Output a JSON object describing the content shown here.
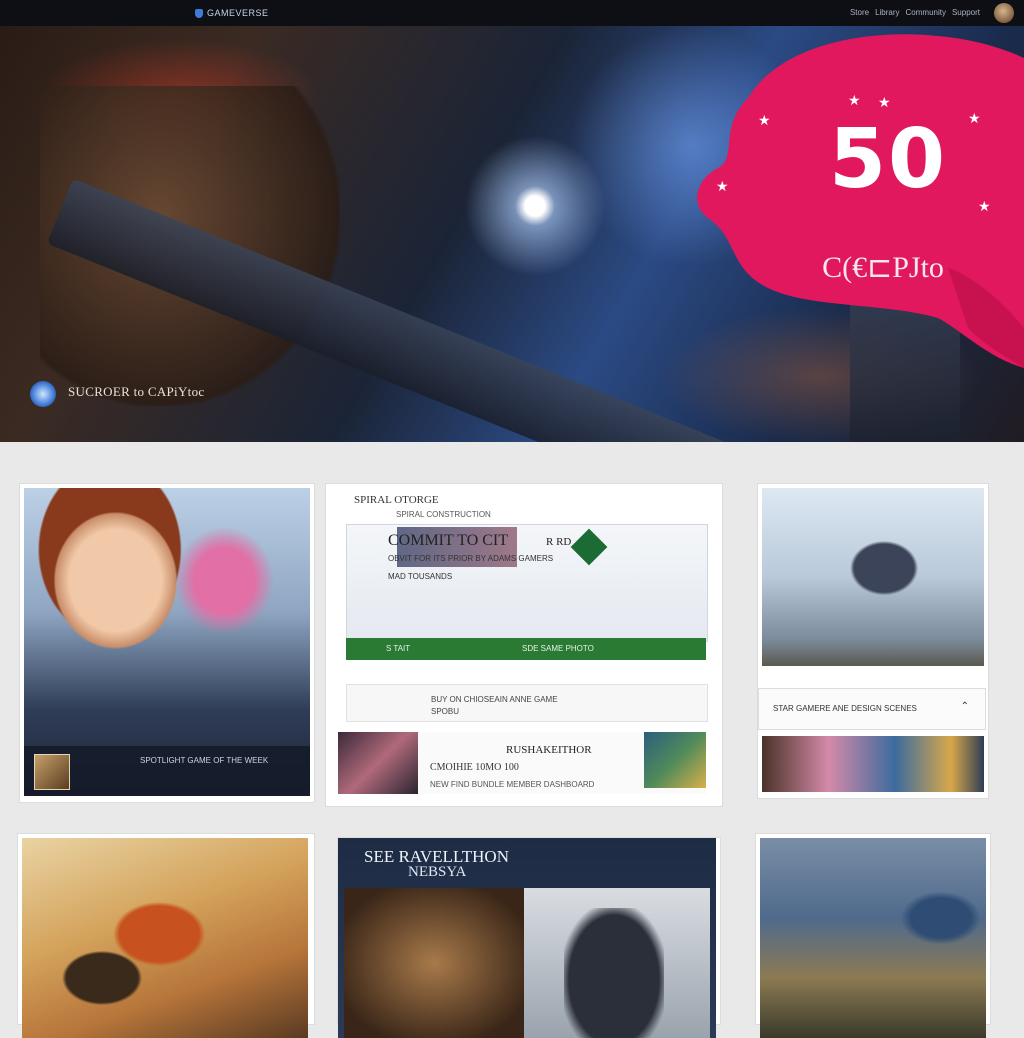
{
  "topbar": {
    "logo_text": "GAMEVERSE",
    "nav_items": [
      "Store",
      "Library",
      "Community",
      "Support"
    ]
  },
  "hero": {
    "caption": "SUCROER to CAPiYtoc",
    "promo_value": "50",
    "promo_label": "C(€⊏PJto"
  },
  "cards": {
    "card1": {
      "caption_line1": "SPOTLIGHT GAME OF THE WEEK",
      "caption_line2": "",
      "caption_line3": ""
    },
    "card2": {
      "title": "SPIRAL OTORGE",
      "subtitle": "SPIRAL CONSTRUCTION",
      "heading": "COMMIT TO CIT",
      "heading_suffix": "R  RD",
      "line1": "OBVIT FOR ITS PRIOR BY ADAMS GAMERS",
      "line2": "MAD TOUSANDS",
      "green_btn1": "S TAIT",
      "green_btn2": "SDE SAME PHOTO",
      "row_title": "BUY ON CHIOSEAIN ANNE GAME",
      "row_sub": "SPOBU",
      "row2_title": "RUSHAKEITHOR",
      "row2_sub": "CMOIHIE 10MO 100",
      "row2_meta": "NEW FIND BUNDLE MEMBER DASHBOARD"
    },
    "card3": {
      "search_text": "STAR GAMERE ANE DESIGN SCENES",
      "search_icon_glyph": "⌃"
    },
    "card5": {
      "title_line1": "SEE RAVELLTHON",
      "title_line2": "NEBSYA"
    }
  },
  "colors": {
    "accent_pink": "#e2185f",
    "action_green": "#2a7a34",
    "topbar_bg": "#0d0f14"
  },
  "icons": {
    "promo": "star-icon",
    "green_diamond": "diamond-icon",
    "search_arrow": "caret-up-icon"
  }
}
